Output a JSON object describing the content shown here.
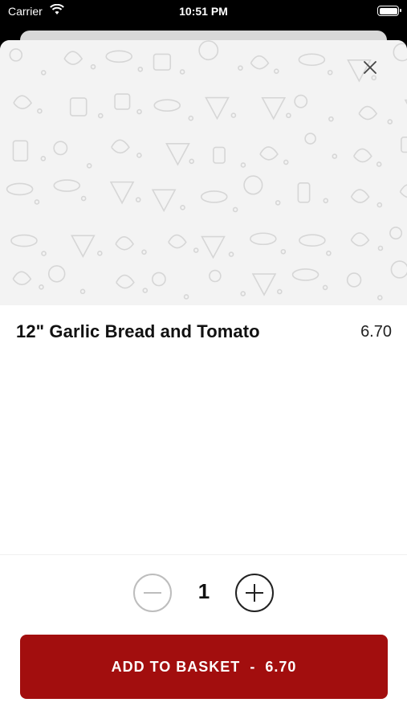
{
  "status_bar": {
    "carrier": "Carrier",
    "time": "10:51 PM"
  },
  "product": {
    "name": "12\" Garlic Bread and Tomato",
    "price": "6.70"
  },
  "stepper": {
    "quantity": "1"
  },
  "add_button": {
    "label": "ADD TO BASKET",
    "separator": "-",
    "price": "6.70"
  },
  "colors": {
    "accent": "#a20e0e",
    "hero_background": "#f3f3f3"
  },
  "icons": {
    "close": "close-icon",
    "minus": "minus-icon",
    "plus": "plus-icon",
    "wifi": "wifi-icon",
    "battery": "battery-icon"
  }
}
